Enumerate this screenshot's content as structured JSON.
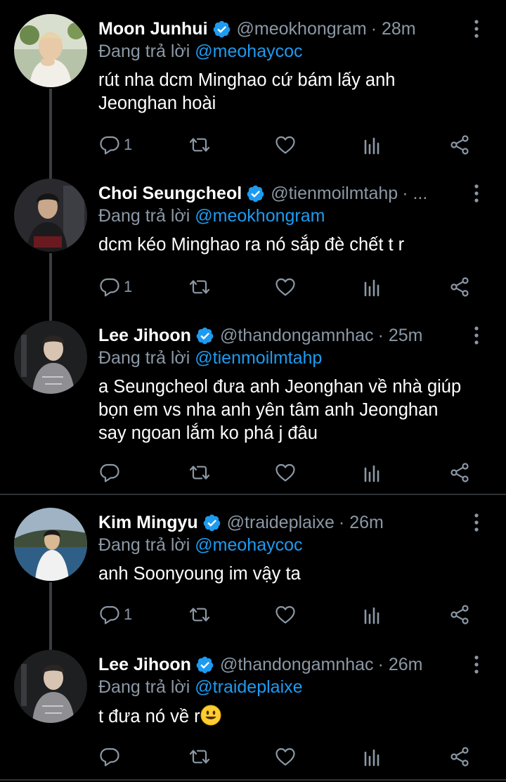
{
  "colors": {
    "background": "#000000",
    "secondary_text": "#8b98a5",
    "link": "#1d9bf0",
    "verified": "#1d9bf0",
    "thread_line": "#3a3e43"
  },
  "tweets": [
    {
      "name": "Moon Junhui",
      "handle": "@meokhongram",
      "time": "· 28m",
      "reply_prefix": "Đang trả lời",
      "reply_mention": "@meohaycoc",
      "text": "rút nha dcm Minghao cứ bám lấy anh Jeonghan hoài",
      "reply_count": "1"
    },
    {
      "name": "Choi Seungcheol",
      "handle": "@tienmoilmtahp",
      "time": "· ...",
      "reply_prefix": "Đang trả lời",
      "reply_mention": "@meokhongram",
      "text": "dcm kéo Minghao ra nó sắp đè chết t r",
      "reply_count": "1"
    },
    {
      "name": "Lee Jihoon",
      "handle": "@thandongamnhac",
      "time": "· 25m",
      "reply_prefix": "Đang trả lời",
      "reply_mention": "@tienmoilmtahp",
      "text": "a Seungcheol đưa anh Jeonghan về nhà giúp bọn em vs nha anh yên tâm anh Jeonghan say ngoan lắm ko phá j đâu",
      "reply_count": ""
    },
    {
      "name": "Kim Mingyu",
      "handle": "@traideplaixe",
      "time": "· 26m",
      "reply_prefix": "Đang trả lời",
      "reply_mention": "@meohaycoc",
      "text": "anh Soonyoung im vậy ta",
      "reply_count": "1"
    },
    {
      "name": "Lee Jihoon",
      "handle": "@thandongamnhac",
      "time": "· 26m",
      "reply_prefix": "Đang trả lời",
      "reply_mention": "@traideplaixe",
      "text": "t đưa nó về r",
      "text_emoji": "smiling-face-emoji",
      "reply_count": ""
    }
  ],
  "icons": [
    "verified-badge-icon",
    "more-vertical-icon",
    "reply-icon",
    "retweet-icon",
    "like-icon",
    "analytics-icon",
    "share-icon"
  ]
}
